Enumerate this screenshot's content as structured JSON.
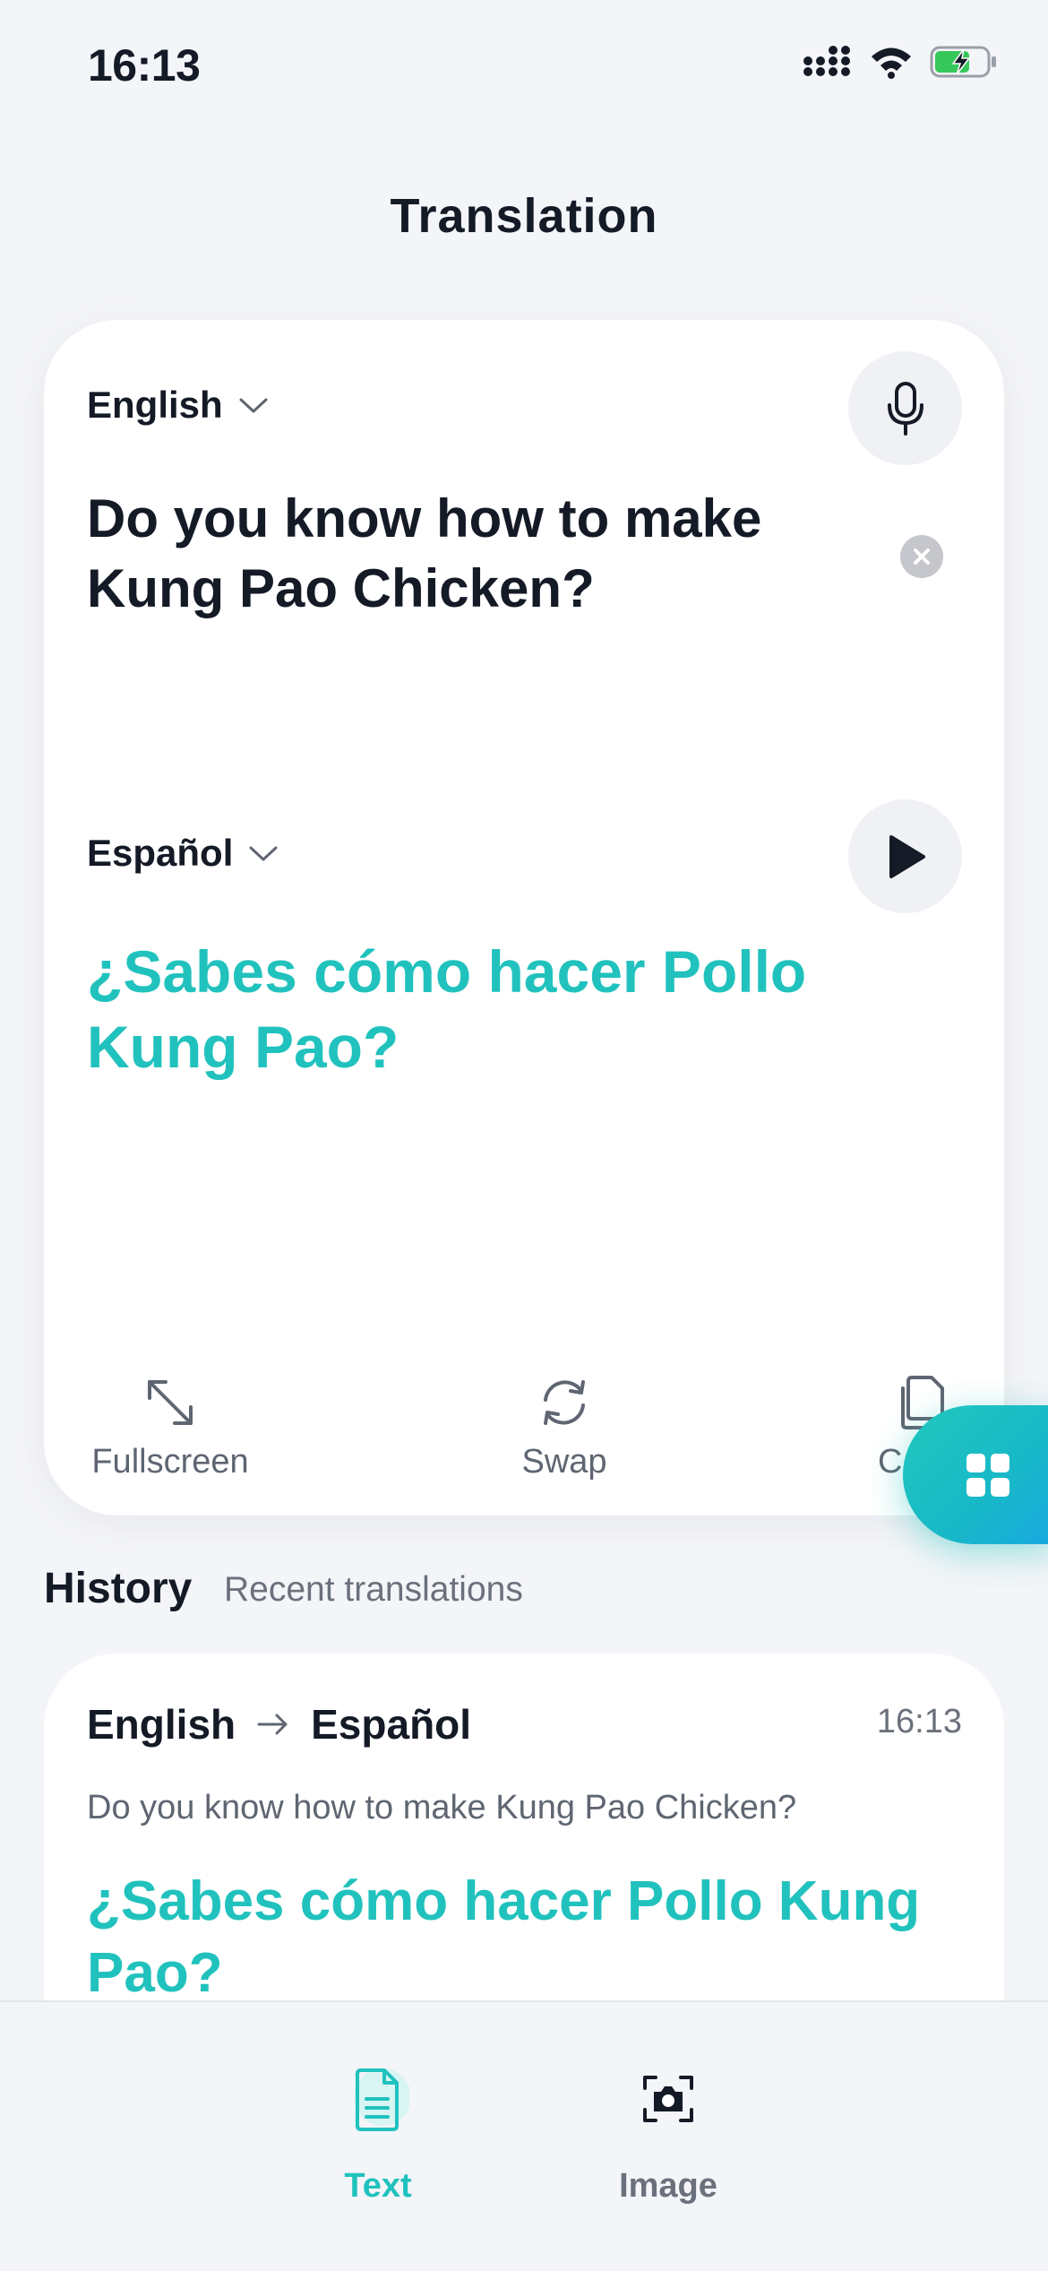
{
  "status_bar": {
    "time": "16:13"
  },
  "header": {
    "title": "Translation"
  },
  "translator": {
    "source_language": "English",
    "source_text": "Do you know how to make Kung Pao Chicken?",
    "target_language": "Español",
    "target_text": "¿Sabes cómo hacer Pollo Kung Pao?",
    "actions": [
      {
        "label": "Fullscreen",
        "icon": "fullscreen-icon"
      },
      {
        "label": "Swap",
        "icon": "swap-icon"
      },
      {
        "label": "Copy",
        "visible_label": "C",
        "icon": "copy-icon"
      }
    ]
  },
  "history": {
    "title": "History",
    "subtitle": "Recent translations",
    "items": [
      {
        "from": "English",
        "to": "Español",
        "time": "16:13",
        "source": "Do you know how to make Kung Pao Chicken?",
        "target": "¿Sabes cómo hacer Pollo Kung Pao?"
      }
    ]
  },
  "tabbar": {
    "tabs": [
      {
        "label": "Text",
        "icon": "document-icon",
        "active": true
      },
      {
        "label": "Image",
        "icon": "camera-icon",
        "active": false
      }
    ]
  },
  "colors": {
    "accent": "#21c2bd",
    "background": "#f4f5f8",
    "text": "#141a26"
  }
}
